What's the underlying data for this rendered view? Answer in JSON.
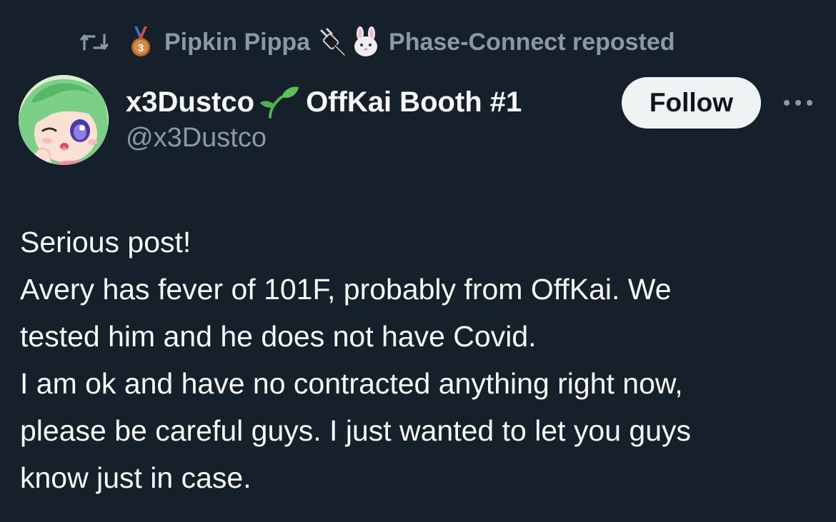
{
  "repost": {
    "reposter_name": "Pipkin Pippa",
    "suffix": "Phase-Connect reposted",
    "icons": [
      "repost-icon",
      "bronze-medal-icon",
      "plug-icon",
      "bunny-icon"
    ]
  },
  "author": {
    "display_name_prefix": "x3Dustco",
    "display_name_suffix": "OffKai Booth #1",
    "handle": "@x3Dustco",
    "name_icon": "sprout-icon",
    "avatar": "avatar"
  },
  "actions": {
    "follow_label": "Follow",
    "more_icon": "more-icon"
  },
  "post": {
    "lines": [
      "Serious post!",
      "Avery has fever of 101F, probably from OffKai. We",
      "tested him and he does not have Covid.",
      "I am ok and have no contracted anything right now,",
      "please be careful guys. I just wanted to let you guys",
      "know just in case."
    ]
  },
  "colors": {
    "background": "#15202b",
    "primary_text": "#f7f9f9",
    "secondary_text": "#8b98a5",
    "follow_button_bg": "#eff3f4",
    "follow_button_text": "#0f1419"
  }
}
